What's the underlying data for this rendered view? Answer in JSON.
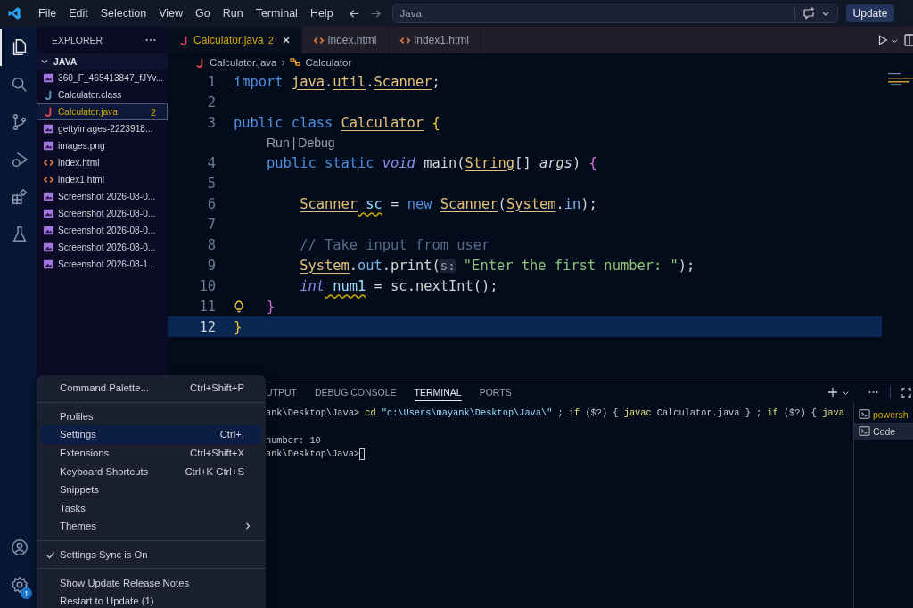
{
  "title_bar": {
    "menus": [
      "File",
      "Edit",
      "Selection",
      "View",
      "Go",
      "Run",
      "Terminal",
      "Help"
    ],
    "search": {
      "value": "Java"
    },
    "update_button": "Update"
  },
  "activity_bar": {
    "top": [
      {
        "kind": "files",
        "selected": true
      },
      {
        "kind": "search",
        "selected": false
      },
      {
        "kind": "source-control",
        "selected": false
      },
      {
        "kind": "run-debug",
        "selected": false
      },
      {
        "kind": "extensions",
        "selected": false
      },
      {
        "kind": "testing",
        "selected": false
      }
    ],
    "bottom": [
      {
        "kind": "account"
      },
      {
        "kind": "settings",
        "badge": "1"
      }
    ]
  },
  "sidebar": {
    "title": "EXPLORER",
    "folder": {
      "name": "JAVA",
      "expanded": true
    },
    "files": [
      {
        "name": "360_F_465413847_fJYv...",
        "kind": "image",
        "selected": false
      },
      {
        "name": "Calculator.class",
        "kind": "class",
        "selected": false
      },
      {
        "name": "Calculator.java",
        "kind": "java",
        "selected": true,
        "badge": "2"
      },
      {
        "name": "gettyimages-2223918...",
        "kind": "image",
        "selected": false
      },
      {
        "name": "images.png",
        "kind": "image",
        "selected": false
      },
      {
        "name": "index.html",
        "kind": "html",
        "selected": false
      },
      {
        "name": "index1.html",
        "kind": "html",
        "selected": false
      },
      {
        "name": "Screenshot 2026-08-0...",
        "kind": "image",
        "selected": false
      },
      {
        "name": "Screenshot 2026-08-0...",
        "kind": "image",
        "selected": false
      },
      {
        "name": "Screenshot 2026-08-0...",
        "kind": "image",
        "selected": false
      },
      {
        "name": "Screenshot 2026-08-0...",
        "kind": "image",
        "selected": false
      },
      {
        "name": "Screenshot 2026-08-1...",
        "kind": "image",
        "selected": false
      }
    ]
  },
  "tabs": [
    {
      "label": "Calculator.java",
      "kind": "java",
      "badge": "2",
      "selected": true
    },
    {
      "label": "index.html",
      "kind": "html",
      "selected": false
    },
    {
      "label": "index1.html",
      "kind": "html",
      "selected": false
    }
  ],
  "breadcrumb": [
    {
      "label": "Calculator.java",
      "kind": "java"
    },
    {
      "label": "Calculator",
      "kind": "class"
    }
  ],
  "code": {
    "lines": [
      {
        "kind": "code",
        "number": "1",
        "selected": false,
        "tokens": [
          {
            "text": "import ",
            "kind": "kw"
          },
          {
            "text": "java",
            "kind": "type"
          },
          {
            "text": ".",
            "kind": "plain"
          },
          {
            "text": "util",
            "kind": "type"
          },
          {
            "text": ".",
            "kind": "plain"
          },
          {
            "text": "Scanner",
            "kind": "type"
          },
          {
            "text": ";",
            "kind": "plain"
          }
        ]
      },
      {
        "kind": "code",
        "number": "2",
        "selected": false
      },
      {
        "kind": "code",
        "number": "3",
        "selected": false,
        "tokens": [
          {
            "text": "public class ",
            "kind": "kw"
          },
          {
            "text": "Calculator",
            "kind": "type"
          },
          {
            "text": " {",
            "kind": "bracket1"
          }
        ]
      },
      {
        "kind": "lens",
        "items": [
          "Run",
          "|",
          "Debug"
        ]
      },
      {
        "kind": "code",
        "number": "4",
        "selected": false,
        "tokens": [
          {
            "text": "    public static ",
            "kind": "kw"
          },
          {
            "text": "void",
            "kind": "italic-kw"
          },
          {
            "text": " main(",
            "kind": "plain"
          },
          {
            "text": "String",
            "kind": "type"
          },
          {
            "text": "[] ",
            "kind": "plain"
          },
          {
            "text": "args",
            "kind": "param"
          },
          {
            "text": ") ",
            "kind": "plain"
          },
          {
            "text": "{",
            "kind": "bracket2"
          }
        ]
      },
      {
        "kind": "code",
        "number": "5",
        "selected": false
      },
      {
        "kind": "code",
        "number": "6",
        "selected": false,
        "tokens": [
          {
            "text": "        Scanner",
            "kind": "type"
          },
          {
            "text": " sc",
            "kind": "warn"
          },
          {
            "text": " = ",
            "kind": "plain"
          },
          {
            "text": "new ",
            "kind": "kw"
          },
          {
            "text": "Scanner",
            "kind": "type"
          },
          {
            "text": "(",
            "kind": "plain"
          },
          {
            "text": "System",
            "kind": "type"
          },
          {
            "text": ".",
            "kind": "plain"
          },
          {
            "text": "in",
            "kind": "field"
          },
          {
            "text": ");",
            "kind": "plain"
          }
        ]
      },
      {
        "kind": "code",
        "number": "7",
        "selected": false
      },
      {
        "kind": "code",
        "number": "8",
        "selected": false,
        "tokens": [
          {
            "text": "        // Take input from user",
            "kind": "comment"
          }
        ]
      },
      {
        "kind": "code",
        "number": "9",
        "selected": false,
        "tokens": [
          {
            "text": "        System",
            "kind": "type"
          },
          {
            "text": ".",
            "kind": "plain"
          },
          {
            "text": "out",
            "kind": "field"
          },
          {
            "text": ".print(",
            "kind": "plain"
          },
          {
            "text": "s:",
            "kind": "hint"
          },
          {
            "text": " \"Enter the first number: \"",
            "kind": "str"
          },
          {
            "text": ");",
            "kind": "plain"
          }
        ]
      },
      {
        "kind": "code",
        "number": "10",
        "selected": false,
        "tokens": [
          {
            "text": "        int",
            "kind": "italic-kw"
          },
          {
            "text": " num1",
            "kind": "warn"
          },
          {
            "text": " = sc.nextInt();",
            "kind": "plain"
          }
        ]
      },
      {
        "kind": "code",
        "number": "11",
        "selected": false,
        "lightbulb": true,
        "tokens": [
          {
            "text": "    }",
            "kind": "bracket2"
          }
        ]
      },
      {
        "kind": "code",
        "number": "12",
        "selected": true,
        "tokens": [
          {
            "text": "}",
            "kind": "bracket1"
          }
        ]
      }
    ]
  },
  "panel": {
    "tabs": [
      {
        "label": "UTPUT",
        "selected": false
      },
      {
        "label": "DEBUG CONSOLE",
        "selected": false
      },
      {
        "label": "TERMINAL",
        "selected": true
      },
      {
        "label": "PORTS",
        "selected": false
      }
    ],
    "terminal_lines": [
      {
        "segments": [
          {
            "text": "ank\\Desktop\\Java> ",
            "kind": "plain"
          },
          {
            "text": "cd ",
            "kind": "cmd"
          },
          {
            "text": "\"c:\\Users\\mayank\\Desktop\\Java\\\"",
            "kind": "str"
          },
          {
            "text": " ; ",
            "kind": "plain"
          },
          {
            "text": "if ",
            "kind": "cmd"
          },
          {
            "text": "($?) { ",
            "kind": "plain"
          },
          {
            "text": "javac ",
            "kind": "cmd"
          },
          {
            "text": "Calculator.java } ; ",
            "kind": "plain"
          },
          {
            "text": "if ",
            "kind": "cmd"
          },
          {
            "text": "($?) { ",
            "kind": "plain"
          },
          {
            "text": "java",
            "kind": "cmd"
          }
        ]
      },
      {
        "segments": [
          {
            "text": "number: 10",
            "kind": "plain"
          }
        ]
      },
      {
        "cursor": true,
        "segments": [
          {
            "text": "ank\\Desktop\\Java>",
            "kind": "plain"
          }
        ]
      }
    ],
    "terminals": [
      {
        "label": "powersh",
        "selected": false
      },
      {
        "label": "Code",
        "selected": true
      }
    ]
  },
  "menu": {
    "groups": [
      [
        {
          "label": "Command Palette...",
          "shortcut": "Ctrl+Shift+P",
          "selected": false,
          "checked": false
        }
      ],
      [
        {
          "label": "Profiles",
          "selected": false,
          "checked": false
        },
        {
          "label": "Settings",
          "shortcut": "Ctrl+,",
          "selected": true,
          "checked": false
        },
        {
          "label": "Extensions",
          "shortcut": "Ctrl+Shift+X",
          "selected": false,
          "checked": false
        },
        {
          "label": "Keyboard Shortcuts",
          "shortcut": "Ctrl+K Ctrl+S",
          "selected": false,
          "checked": false
        },
        {
          "label": "Snippets",
          "selected": false,
          "checked": false
        },
        {
          "label": "Tasks",
          "selected": false,
          "checked": false
        },
        {
          "label": "Themes",
          "selected": false,
          "checked": false,
          "submenu": true
        }
      ],
      [
        {
          "label": "Settings Sync is On",
          "selected": false,
          "checked": true
        }
      ],
      [
        {
          "label": "Show Update Release Notes",
          "selected": false,
          "checked": false
        },
        {
          "label": "Restart to Update (1)",
          "selected": false,
          "checked": false
        }
      ]
    ]
  }
}
